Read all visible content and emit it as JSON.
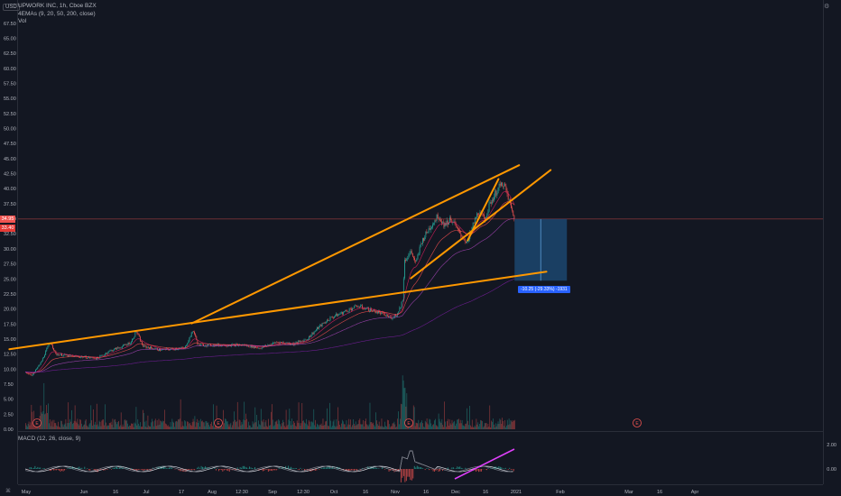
{
  "header": {
    "currency": "USD",
    "title": "UPWORK INC, 1h, Cboe BZX",
    "indicator": "4EMAs (9, 20, 50, 200, close)",
    "vol": "Vol"
  },
  "macd_label": "MACD (12, 26, close, 9)",
  "price_tags": {
    "last": "34.95",
    "prev": "33.40"
  },
  "measure_label": "-10.25 (-29.33%) -1931",
  "colors": {
    "background": "#131722",
    "trendline": "#ff9800",
    "up": "#26a69a",
    "down": "#ef5350",
    "macd_line": "#2962ff",
    "signal_line": "#ff6d00",
    "divergence": "#e040fb",
    "measure_fill": "#1e4e79"
  },
  "chart_data": {
    "type": "candlestick",
    "price_axis": {
      "ticks": [
        "0.00",
        "2.50",
        "5.00",
        "7.50",
        "10.00",
        "12.50",
        "15.00",
        "17.50",
        "20.00",
        "22.50",
        "25.00",
        "27.50",
        "30.00",
        "32.50",
        "35.00",
        "37.50",
        "40.00",
        "42.50",
        "45.00",
        "47.50",
        "50.00",
        "52.50",
        "55.00",
        "57.50",
        "60.00",
        "62.50",
        "65.00",
        "67.50"
      ],
      "range": [
        0,
        70
      ]
    },
    "time_axis": {
      "ticks": [
        "May",
        "Jun",
        "16",
        "Jul",
        "17",
        "Aug",
        "12:30",
        "Sep",
        "12:30",
        "Oct",
        "16",
        "Nov",
        "16",
        "Dec",
        "16",
        "2021",
        "Feb",
        "Mar",
        "16",
        "Apr"
      ]
    },
    "macd_axis": {
      "ticks": [
        "2.00",
        "0.00"
      ]
    },
    "price_path": [
      {
        "t": 0,
        "p": 9.5
      },
      {
        "t": 4,
        "p": 9.0
      },
      {
        "t": 9,
        "p": 11.0
      },
      {
        "t": 13,
        "p": 13.5
      },
      {
        "t": 15,
        "p": 14.5
      },
      {
        "t": 18,
        "p": 12.5
      },
      {
        "t": 26,
        "p": 12.2
      },
      {
        "t": 35,
        "p": 12.0
      },
      {
        "t": 43,
        "p": 11.8
      },
      {
        "t": 50,
        "p": 13.0
      },
      {
        "t": 58,
        "p": 13.8
      },
      {
        "t": 63,
        "p": 14.5
      },
      {
        "t": 66,
        "p": 16.3
      },
      {
        "t": 70,
        "p": 13.8
      },
      {
        "t": 80,
        "p": 13.2
      },
      {
        "t": 95,
        "p": 13.5
      },
      {
        "t": 100,
        "p": 16.5
      },
      {
        "t": 103,
        "p": 14.0
      },
      {
        "t": 115,
        "p": 14.0
      },
      {
        "t": 130,
        "p": 14.0
      },
      {
        "t": 140,
        "p": 13.5
      },
      {
        "t": 150,
        "p": 14.5
      },
      {
        "t": 160,
        "p": 14.2
      },
      {
        "t": 168,
        "p": 15.0
      },
      {
        "t": 175,
        "p": 17.0
      },
      {
        "t": 182,
        "p": 18.5
      },
      {
        "t": 190,
        "p": 19.5
      },
      {
        "t": 198,
        "p": 20.5
      },
      {
        "t": 204,
        "p": 20.0
      },
      {
        "t": 212,
        "p": 19.3
      },
      {
        "t": 218,
        "p": 18.5
      },
      {
        "t": 222,
        "p": 19.2
      },
      {
        "t": 225,
        "p": 21.5
      },
      {
        "t": 226,
        "p": 28.0
      },
      {
        "t": 230,
        "p": 29.5
      },
      {
        "t": 233,
        "p": 27.5
      },
      {
        "t": 236,
        "p": 31.0
      },
      {
        "t": 240,
        "p": 33.0
      },
      {
        "t": 246,
        "p": 35.5
      },
      {
        "t": 250,
        "p": 34.0
      },
      {
        "t": 254,
        "p": 35.0
      },
      {
        "t": 258,
        "p": 33.0
      },
      {
        "t": 262,
        "p": 31.5
      },
      {
        "t": 264,
        "p": 31.0
      },
      {
        "t": 267,
        "p": 34.0
      },
      {
        "t": 270,
        "p": 36.0
      },
      {
        "t": 274,
        "p": 35.0
      },
      {
        "t": 278,
        "p": 38.0
      },
      {
        "t": 282,
        "p": 40.0
      },
      {
        "t": 285,
        "p": 41.0
      },
      {
        "t": 288,
        "p": 38.5
      },
      {
        "t": 290,
        "p": 36.5
      },
      {
        "t": 292,
        "p": 34.95
      }
    ],
    "trendlines": [
      {
        "from": {
          "t": -9.5,
          "p": 13.3
        },
        "to": {
          "t": 311,
          "p": 26.2
        }
      },
      {
        "from": {
          "t": 99.3,
          "p": 17.6
        },
        "to": {
          "t": 294.7,
          "p": 43.9
        }
      },
      {
        "from": {
          "t": 230.1,
          "p": 25.1
        },
        "to": {
          "t": 313.5,
          "p": 43.1
        }
      },
      {
        "from": {
          "t": 264,
          "p": 31.4
        },
        "to": {
          "t": 282.4,
          "p": 41.6
        }
      }
    ],
    "measure": {
      "t_start": 292,
      "t_end": 320,
      "p_high": 34.95,
      "p_low": 24.7,
      "change": "-10.25",
      "percent": "-29.33%"
    }
  }
}
